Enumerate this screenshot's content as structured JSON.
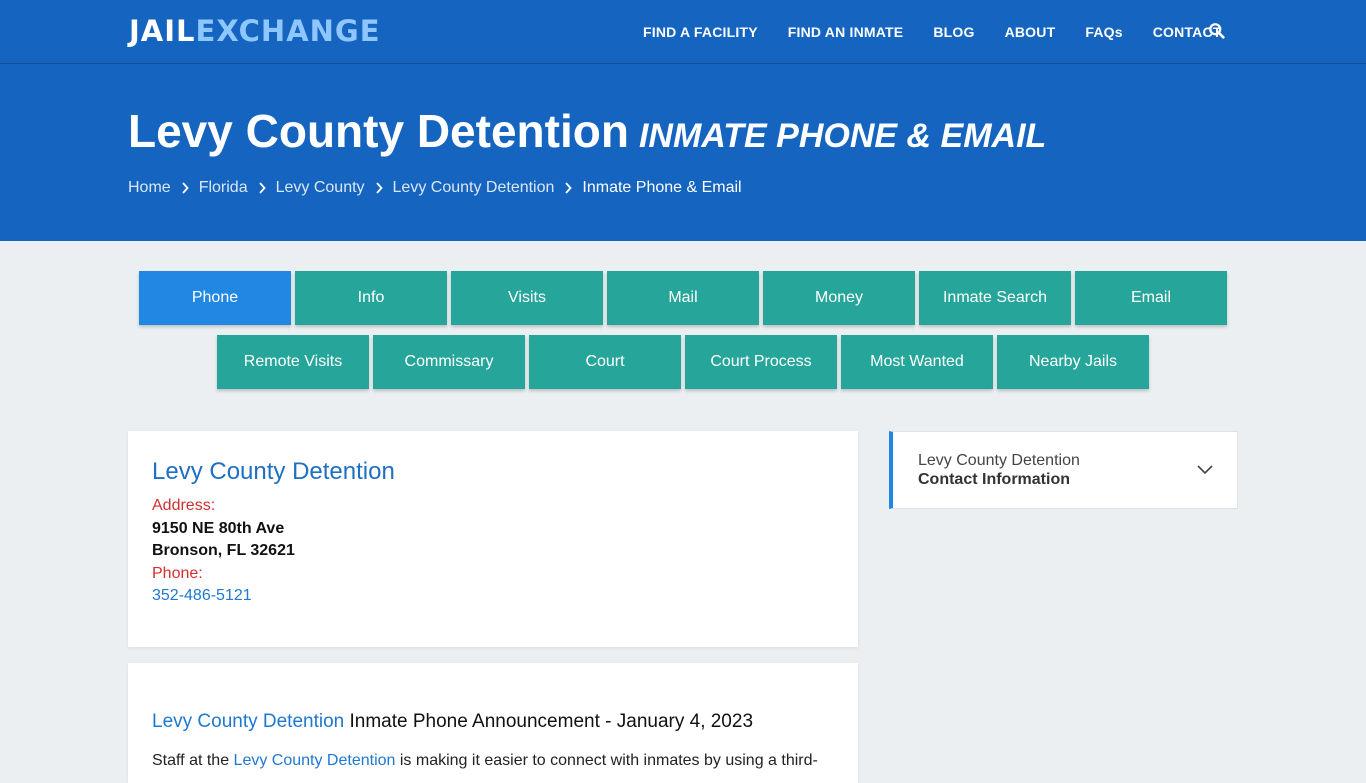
{
  "brand": {
    "part1": "JAIL",
    "part2": "EXCHANGE"
  },
  "nav": {
    "items": [
      "FIND A FACILITY",
      "FIND AN INMATE",
      "BLOG",
      "ABOUT",
      "FAQs",
      "CONTACT"
    ],
    "search_icon": "search-icon"
  },
  "hero": {
    "title": "Levy County Detention",
    "subtitle": "Inmate Phone & Email",
    "breadcrumbs": [
      "Home",
      "Florida",
      "Levy County",
      "Levy County Detention"
    ],
    "current": "Inmate Phone & Email"
  },
  "tabs": {
    "row1": [
      "Phone",
      "Info",
      "Visits",
      "Mail",
      "Money",
      "Inmate Search",
      "Email"
    ],
    "row2": [
      "Remote Visits",
      "Commissary",
      "Court",
      "Court Process",
      "Most Wanted",
      "Nearby Jails"
    ],
    "active": "Phone"
  },
  "facility": {
    "name": "Levy County Detention",
    "address_label": "Address:",
    "address_line1": "9150 NE 80th Ave",
    "address_line2": "Bronson, FL 32621",
    "phone_label": "Phone:",
    "phone": "352-486-5121"
  },
  "announcement": {
    "facility_link": "Levy County Detention",
    "title_rest": " Inmate Phone Announcement - January 4, 2023",
    "body_prefix": "Staff at the ",
    "body_link": "Levy County Detention",
    "body_suffix": " is making it easier to connect with inmates by using a third-"
  },
  "sidebar": {
    "line1": "Levy County Detention",
    "line2": "Contact Information"
  },
  "colors": {
    "header_blue": "#1565c0",
    "tab_teal": "#26a69a",
    "tab_active": "#2088e3",
    "link_blue": "#1f78d1",
    "label_red": "#d32f2f"
  }
}
